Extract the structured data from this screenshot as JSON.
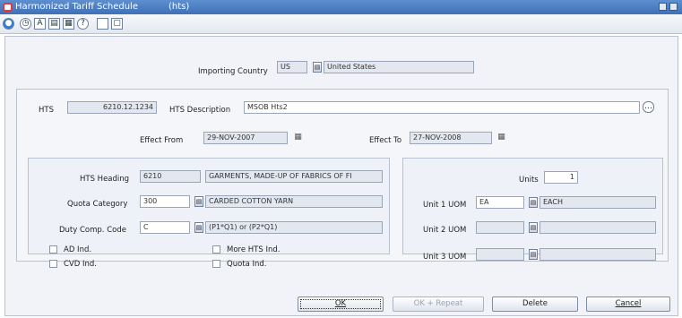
{
  "window": {
    "title": "Harmonized Tariff Schedule",
    "subtitle": "(hts)"
  },
  "toolbar": {
    "icons": [
      "globe-icon",
      "clock-icon",
      "spell-check-icon",
      "notes-icon",
      "print-icon",
      "help-icon",
      "blank-page-icon",
      "copy-page-icon"
    ]
  },
  "importing_country": {
    "label": "Importing Country",
    "code": "US",
    "name": "United States"
  },
  "hts": {
    "label": "HTS",
    "value": "6210.12.1234"
  },
  "hts_description": {
    "label": "HTS Description",
    "value": "MSOB Hts2"
  },
  "effect_from": {
    "label": "Effect From",
    "value": "29-NOV-2007"
  },
  "effect_to": {
    "label": "Effect To",
    "value": "27-NOV-2008"
  },
  "hts_heading": {
    "label": "HTS Heading",
    "code": "6210",
    "desc": "GARMENTS, MADE-UP OF FABRICS OF FI"
  },
  "quota_category": {
    "label": "Quota Category",
    "code": "300",
    "desc": "CARDED COTTON YARN"
  },
  "duty_comp_code": {
    "label": "Duty Comp. Code",
    "code": "C",
    "desc": "(P1*Q1) or (P2*Q1)"
  },
  "checkboxes": {
    "ad_ind": "AD Ind.",
    "cvd_ind": "CVD Ind.",
    "more_hts_ind": "More HTS Ind.",
    "quota_ind": "Quota Ind."
  },
  "units": {
    "label": "Units",
    "value": "1"
  },
  "unit1": {
    "label": "Unit 1 UOM",
    "code": "EA",
    "desc": "EACH"
  },
  "unit2": {
    "label": "Unit 2 UOM",
    "code": "",
    "desc": ""
  },
  "unit3": {
    "label": "Unit 3 UOM",
    "code": "",
    "desc": ""
  },
  "buttons": {
    "ok": "OK",
    "ok_repeat": "OK + Repeat",
    "delete": "Delete",
    "cancel": "Cancel"
  },
  "colors": {
    "titlebar": "#3f70b8",
    "panel": "#f1f3f8",
    "readonly_field": "#e3e7ef"
  }
}
